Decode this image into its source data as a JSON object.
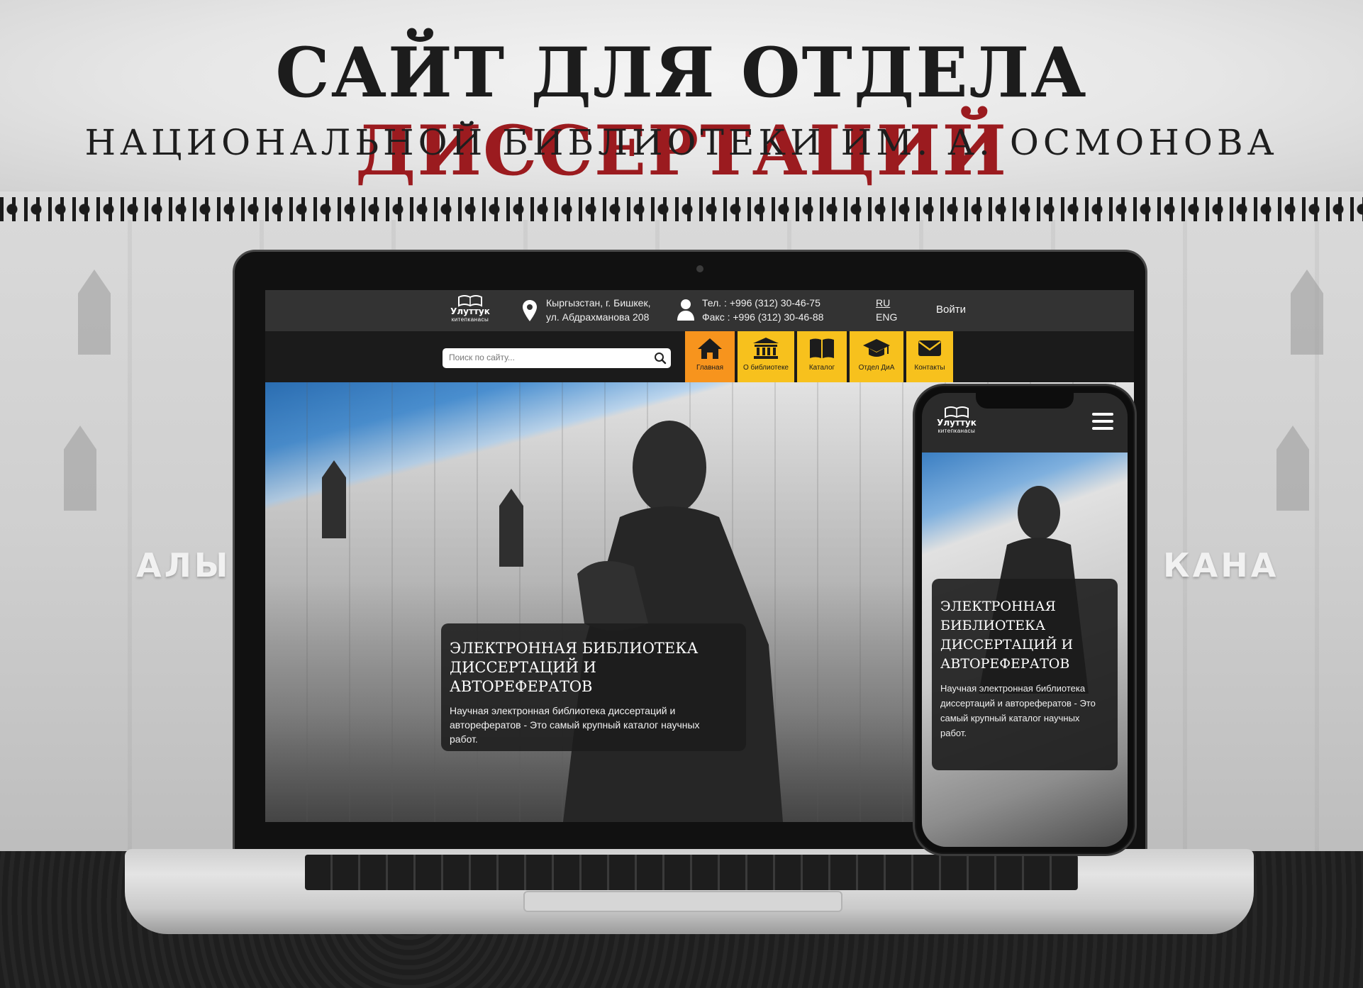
{
  "promo": {
    "headline_part1": "САЙТ ДЛЯ ОТДЕЛА ",
    "headline_part2": "ДИССЕРТАЦИЙ",
    "subheadline": "НАЦИОНАЛЬНОЙ БИБЛИОТЕКИ ИМ. А. ОСМОНОВА",
    "background_sign_left": "АЛЫ",
    "background_sign_right": "КАНА"
  },
  "colors": {
    "accent_red": "#9b1b1f",
    "nav_yellow": "#f7c11d",
    "nav_active_orange": "#f7941d",
    "topbar": "#333333",
    "navbar": "#1b1b1b"
  },
  "site": {
    "logo": {
      "name": "Улуттук",
      "sub": "китепканасы",
      "icon": "open-book-icon"
    },
    "address": {
      "icon": "location-pin-icon",
      "line1": "Кыргызстан, г. Бишкек,",
      "line2": "ул. Абдрахманова 208"
    },
    "contacts": {
      "icon": "person-icon",
      "phone": "Тел. : +996 (312) 30-46-75",
      "fax": "Факс : +996 (312) 30-46-88"
    },
    "lang": {
      "ru": "RU",
      "en": "ENG"
    },
    "login": "Войти",
    "search": {
      "placeholder": "Поиск по сайту...",
      "icon": "search-icon"
    },
    "nav": [
      {
        "label": "Главная",
        "icon": "home-icon",
        "active": true
      },
      {
        "label": "О библиотеке",
        "icon": "library-building-icon",
        "active": false
      },
      {
        "label": "Каталог",
        "icon": "book-icon",
        "active": false
      },
      {
        "label": "Отдел ДиА",
        "icon": "graduation-cap-icon",
        "active": false
      },
      {
        "label": "Контакты",
        "icon": "envelope-icon",
        "active": false
      }
    ],
    "hero": {
      "title_line1": "ЭЛЕКТРОННАЯ БИБЛИОТЕКА",
      "title_line2": "ДИССЕРТАЦИЙ И АВТОРЕФЕРАТОВ",
      "text_line1": "Научная электронная библиотека диссертаций и",
      "text_line2": "авторефератов - Это самый крупный каталог научных",
      "text_line3": "работ."
    }
  },
  "mobile": {
    "logo": {
      "name": "Улуттук",
      "sub": "китепканасы"
    },
    "menu_icon": "hamburger-menu-icon",
    "hero": {
      "title_line1": "ЭЛЕКТРОННАЯ",
      "title_line2": "БИБЛИОТЕКА",
      "title_line3": "ДИССЕРТАЦИЙ И",
      "title_line4": "АВТОРЕФЕРАТОВ",
      "text_line1": "Научная электронная библиотека",
      "text_line2": "диссертаций и авторефератов - Это",
      "text_line3": "самый крупный каталог научных",
      "text_line4": "работ."
    }
  }
}
